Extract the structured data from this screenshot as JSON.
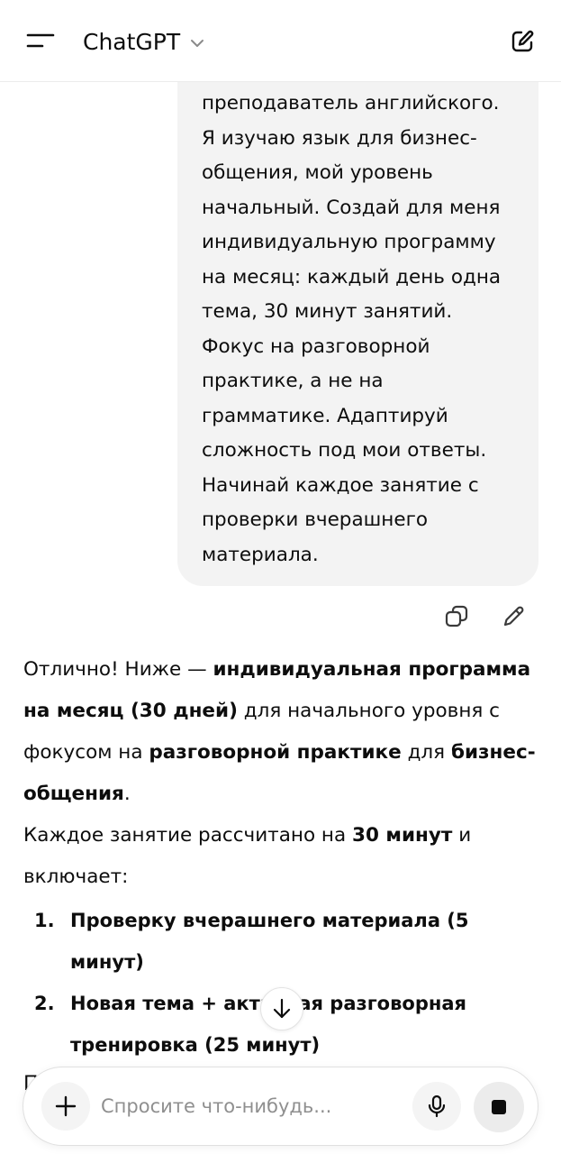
{
  "header": {
    "title": "ChatGPT"
  },
  "user_message": {
    "text": "преподаватель английского.\nЯ изучаю язык для бизнес-\nобщения, мой уровень\nначальный. Создай для меня\nиндивидуальную программу\nна месяц: каждый день одна\nтема, 30 минут занятий.\nФокус на разговорной\nпрактике, а не на\nграмматике. Адаптируй\nсложность под мои ответы.\nНачинай каждое занятие с\nпроверки вчерашнего\nматериала."
  },
  "assistant": {
    "p1": {
      "t1": "Отлично! Ниже — ",
      "b1": "индивидуальная программа на месяц (30 дней)",
      "t2": " для начального уровня с фокусом на ",
      "b2": "разговорной практике",
      "t3": " для ",
      "b3": "бизнес-общения",
      "t4": "."
    },
    "p2": {
      "t1": "Каждое занятие рассчитано на ",
      "b1": "30 минут",
      "t2": " и включает:"
    },
    "list": [
      {
        "num": "1.",
        "text": "Проверку вчерашнего материала (5 минут)"
      },
      {
        "num": "2.",
        "text": "Новая тема + активная разговорная тренировка (25 минут)"
      }
    ],
    "cutoff": "П"
  },
  "composer": {
    "placeholder": "Спросите что-нибудь..."
  },
  "icons": {
    "menu": "menu-icon",
    "chevron": "chevron-down-icon",
    "new_chat": "new-chat-icon",
    "copy": "copy-icon",
    "edit": "pencil-icon",
    "scroll": "arrow-down-icon",
    "plus": "plus-icon",
    "mic": "microphone-icon",
    "stop": "stop-icon"
  }
}
